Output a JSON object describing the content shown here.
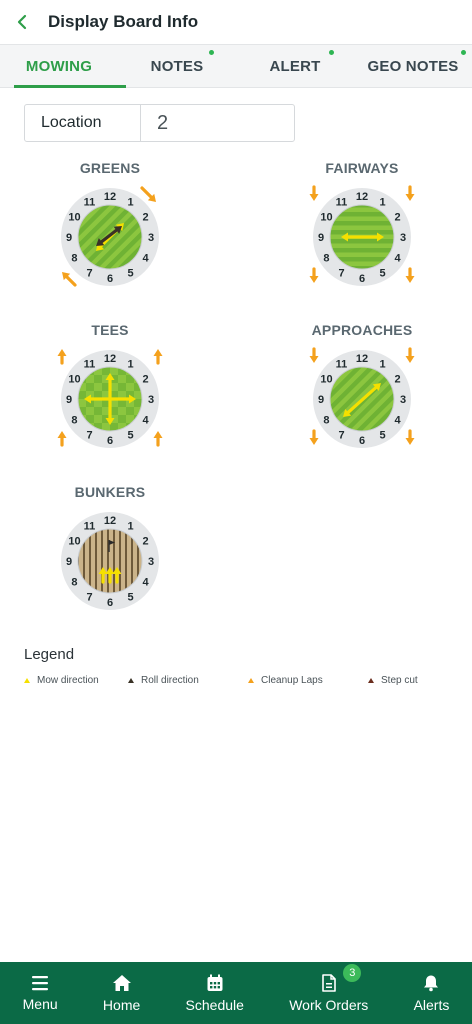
{
  "header": {
    "title": "Display Board Info"
  },
  "tabs": [
    {
      "label": "MOWING",
      "active": true
    },
    {
      "label": "NOTES",
      "has_indicator": true
    },
    {
      "label": "ALERT",
      "has_indicator": true
    },
    {
      "label": "GEO NOTES",
      "has_indicator": true
    }
  ],
  "location": {
    "label": "Location",
    "value": "2"
  },
  "diagrams": [
    {
      "title": "GREENS",
      "pattern": "diagonal-stripes",
      "mow_direction": "2-to-8 (double arrow)",
      "roll_direction": "10-to-4 (double arrow)",
      "cleanup_laps": "clockwise"
    },
    {
      "title": "FAIRWAYS",
      "pattern": "horizontal-stripes",
      "mow_direction": "9-to-3 (double arrow)",
      "step_cut": "down arrows at corners"
    },
    {
      "title": "TEES",
      "pattern": "checkerboard",
      "mow_direction": "cross (four-way)",
      "step_cut": "up arrows at corners"
    },
    {
      "title": "APPROACHES",
      "pattern": "diagonal-stripes",
      "mow_direction": "2-to-8 (double arrow)",
      "step_cut": "down arrows at corners"
    },
    {
      "title": "BUNKERS",
      "pattern": "sand-rake",
      "mow_direction": "up arrows (rake)"
    }
  ],
  "clock_numbers": [
    "12",
    "1",
    "2",
    "3",
    "4",
    "5",
    "6",
    "7",
    "8",
    "9",
    "10",
    "11"
  ],
  "legend": {
    "title": "Legend",
    "items": [
      {
        "label": "Mow direction",
        "color": "#f5e000"
      },
      {
        "label": "Roll direction",
        "color": "#3a3226"
      },
      {
        "label": "Cleanup Laps",
        "color": "#f4a11d"
      },
      {
        "label": "Step cut",
        "color": "#6b2e1e"
      }
    ]
  },
  "bottom_nav": [
    {
      "label": "Menu",
      "icon": "menu-icon"
    },
    {
      "label": "Home",
      "icon": "home-icon"
    },
    {
      "label": "Schedule",
      "icon": "calendar-icon"
    },
    {
      "label": "Work Orders",
      "icon": "document-icon",
      "badge": "3"
    },
    {
      "label": "Alerts",
      "icon": "bell-icon"
    }
  ],
  "colors": {
    "accent": "#2e9e49",
    "nav_bg": "#0b6a46",
    "arrow_orange": "#f4a11d",
    "mow_yellow": "#f5e000",
    "grass_light": "#8cc63f",
    "grass_dark": "#6fb234"
  }
}
